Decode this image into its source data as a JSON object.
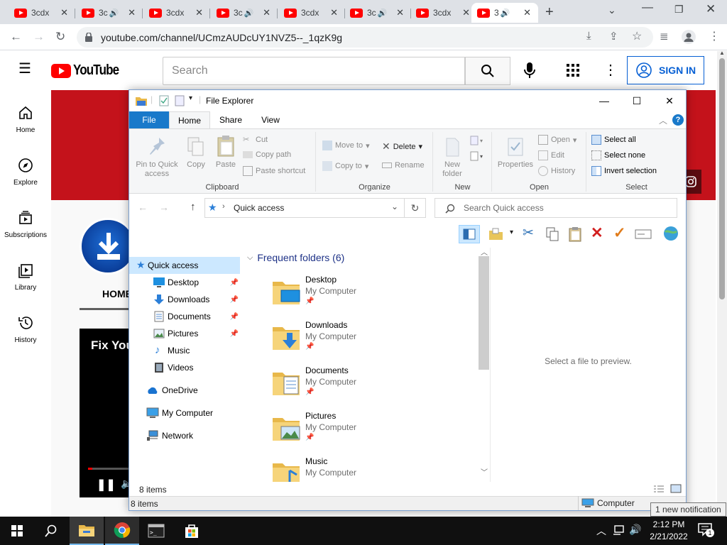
{
  "browser": {
    "tabs": [
      {
        "title": "3cdx",
        "audio": false,
        "active": false
      },
      {
        "title": "3c",
        "audio": true,
        "active": false
      },
      {
        "title": "3cdx",
        "audio": false,
        "active": false
      },
      {
        "title": "3c",
        "audio": true,
        "active": false
      },
      {
        "title": "3cdx",
        "audio": false,
        "active": false
      },
      {
        "title": "3c",
        "audio": true,
        "active": false
      },
      {
        "title": "3cdx",
        "audio": false,
        "active": false
      },
      {
        "title": "3",
        "audio": true,
        "active": true
      }
    ],
    "url": "youtube.com/channel/UCmzAUDcUY1NVZ5--_1qzK9g"
  },
  "youtube": {
    "logo": "YouTube",
    "search_placeholder": "Search",
    "signin_label": "SIGN IN",
    "nav": [
      {
        "label": "Home",
        "icon": "home-icon"
      },
      {
        "label": "Explore",
        "icon": "compass-icon"
      },
      {
        "label": "Subscriptions",
        "icon": "subscriptions-icon"
      },
      {
        "label": "Library",
        "icon": "library-icon"
      },
      {
        "label": "History",
        "icon": "history-icon"
      }
    ],
    "channel_tab": "HOME",
    "video_title": "Fix You",
    "colors": {
      "brand_red": "#ff0000",
      "banner": "#c4121b",
      "signin_blue": "#065fd4"
    }
  },
  "explorer": {
    "title": "File Explorer",
    "ribbon_tabs": [
      "File",
      "Home",
      "Share",
      "View"
    ],
    "clipboard": {
      "pin": "Pin to Quick access",
      "copy": "Copy",
      "paste": "Paste",
      "cut": "Cut",
      "copy_path": "Copy path",
      "paste_shortcut": "Paste shortcut",
      "label": "Clipboard"
    },
    "organize": {
      "move_to": "Move to",
      "delete": "Delete",
      "copy_to": "Copy to",
      "rename": "Rename",
      "label": "Organize"
    },
    "new": {
      "new_folder": "New folder",
      "label": "New"
    },
    "open": {
      "properties": "Properties",
      "open": "Open",
      "edit": "Edit",
      "history": "History",
      "label": "Open"
    },
    "select": {
      "select_all": "Select all",
      "select_none": "Select none",
      "invert": "Invert selection",
      "label": "Select"
    },
    "address": "Quick access",
    "search_placeholder": "Search Quick access",
    "nav": [
      {
        "label": "Quick access",
        "selected": true,
        "pinned": false,
        "indent": 0
      },
      {
        "label": "Desktop",
        "selected": false,
        "pinned": true,
        "indent": 1
      },
      {
        "label": "Downloads",
        "selected": false,
        "pinned": true,
        "indent": 1
      },
      {
        "label": "Documents",
        "selected": false,
        "pinned": true,
        "indent": 1
      },
      {
        "label": "Pictures",
        "selected": false,
        "pinned": true,
        "indent": 1
      },
      {
        "label": "Music",
        "selected": false,
        "pinned": false,
        "indent": 1
      },
      {
        "label": "Videos",
        "selected": false,
        "pinned": false,
        "indent": 1
      },
      {
        "label": "OneDrive",
        "selected": false,
        "pinned": false,
        "indent": 0
      },
      {
        "label": "My Computer",
        "selected": false,
        "pinned": false,
        "indent": 0
      },
      {
        "label": "Network",
        "selected": false,
        "pinned": false,
        "indent": 0
      }
    ],
    "section_title": "Frequent folders (6)",
    "folders": [
      {
        "name": "Desktop",
        "location": "My Computer"
      },
      {
        "name": "Downloads",
        "location": "My Computer"
      },
      {
        "name": "Documents",
        "location": "My Computer"
      },
      {
        "name": "Pictures",
        "location": "My Computer"
      },
      {
        "name": "Music",
        "location": "My Computer"
      }
    ],
    "preview_text": "Select a file to preview.",
    "item_count": "8 items",
    "status_items": "8 items",
    "status_location": "Computer"
  },
  "taskbar": {
    "time": "2:12 PM",
    "date": "2/21/2022",
    "notification_badge": "1",
    "toast": "1 new notification"
  }
}
